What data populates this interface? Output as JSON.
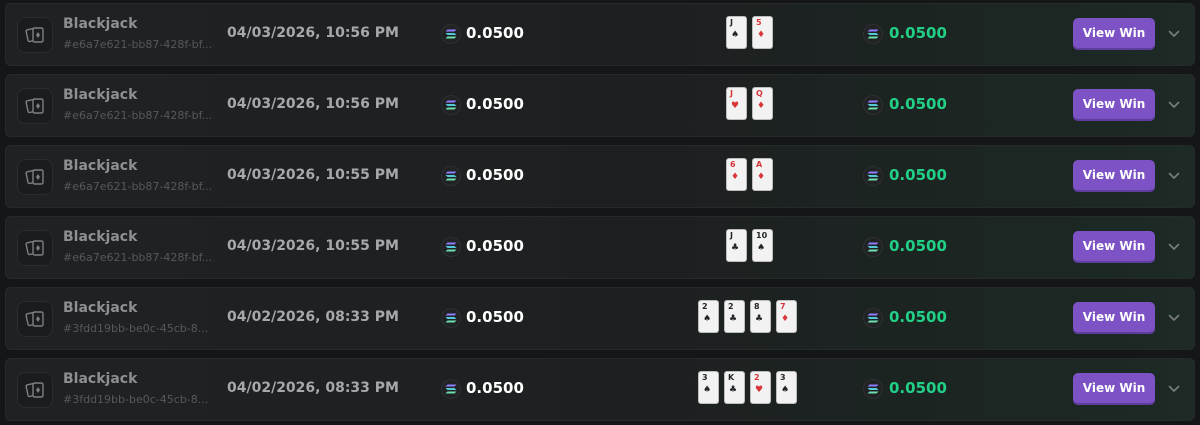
{
  "colors": {
    "accent": "#7c52c4",
    "payout_green": "#21d086",
    "card_red": "#d8363b",
    "card_black": "#222629"
  },
  "icons": {
    "game": "playing-cards-icon",
    "currency": "solana-coin-icon",
    "expand": "chevron-down-icon"
  },
  "rows": [
    {
      "game": "Blackjack",
      "id": "#e6a7e621-bb87-428f-bf...",
      "date": "04/03/2026, 10:56 PM",
      "bet": "0.0500",
      "payout": "0.0500",
      "action": "View Win",
      "cards": [
        {
          "rank": "J",
          "suit": "♠",
          "color": "black"
        },
        {
          "rank": "5",
          "suit": "♦",
          "color": "red"
        }
      ]
    },
    {
      "game": "Blackjack",
      "id": "#e6a7e621-bb87-428f-bf...",
      "date": "04/03/2026, 10:56 PM",
      "bet": "0.0500",
      "payout": "0.0500",
      "action": "View Win",
      "cards": [
        {
          "rank": "J",
          "suit": "♥",
          "color": "red"
        },
        {
          "rank": "Q",
          "suit": "♦",
          "color": "red"
        }
      ]
    },
    {
      "game": "Blackjack",
      "id": "#e6a7e621-bb87-428f-bf...",
      "date": "04/03/2026, 10:55 PM",
      "bet": "0.0500",
      "payout": "0.0500",
      "action": "View Win",
      "cards": [
        {
          "rank": "6",
          "suit": "♦",
          "color": "red"
        },
        {
          "rank": "A",
          "suit": "♦",
          "color": "red"
        }
      ]
    },
    {
      "game": "Blackjack",
      "id": "#e6a7e621-bb87-428f-bf...",
      "date": "04/03/2026, 10:55 PM",
      "bet": "0.0500",
      "payout": "0.0500",
      "action": "View Win",
      "cards": [
        {
          "rank": "J",
          "suit": "♣",
          "color": "black"
        },
        {
          "rank": "10",
          "suit": "♠",
          "color": "black"
        }
      ]
    },
    {
      "game": "Blackjack",
      "id": "#3fdd19bb-be0c-45cb-8...",
      "date": "04/02/2026, 08:33 PM",
      "bet": "0.0500",
      "payout": "0.0500",
      "action": "View Win",
      "cards": [
        {
          "rank": "2",
          "suit": "♠",
          "color": "black"
        },
        {
          "rank": "2",
          "suit": "♣",
          "color": "black"
        },
        {
          "rank": "8",
          "suit": "♣",
          "color": "black"
        },
        {
          "rank": "7",
          "suit": "♦",
          "color": "red"
        }
      ]
    },
    {
      "game": "Blackjack",
      "id": "#3fdd19bb-be0c-45cb-8...",
      "date": "04/02/2026, 08:33 PM",
      "bet": "0.0500",
      "payout": "0.0500",
      "action": "View Win",
      "cards": [
        {
          "rank": "3",
          "suit": "♠",
          "color": "black"
        },
        {
          "rank": "K",
          "suit": "♣",
          "color": "black"
        },
        {
          "rank": "2",
          "suit": "♥",
          "color": "red"
        },
        {
          "rank": "3",
          "suit": "♠",
          "color": "black"
        }
      ]
    }
  ]
}
